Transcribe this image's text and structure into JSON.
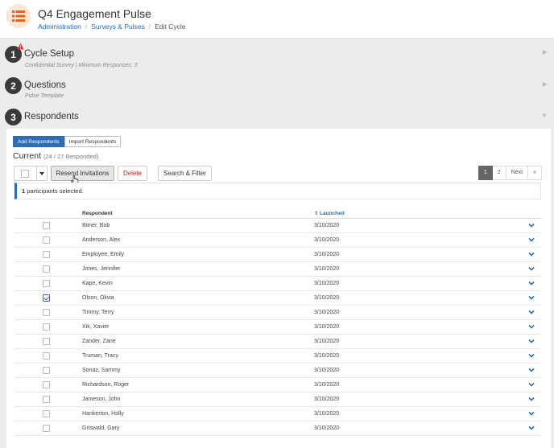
{
  "header": {
    "title": "Q4 Engagement Pulse",
    "breadcrumb": [
      "Administration",
      "Surveys & Pulses",
      "Edit Cycle"
    ],
    "icon": "list-icon",
    "accent": "#e8641b"
  },
  "steps": [
    {
      "number": "1",
      "title": "Cycle Setup",
      "subtitle": "Confidential Survey | Minimum Responses: 3"
    },
    {
      "number": "2",
      "title": "Questions",
      "subtitle": "Pulse Template"
    },
    {
      "number": "3",
      "title": "Respondents",
      "subtitle": ""
    }
  ],
  "respondents": {
    "tabs": [
      "Add Respondents",
      "Import Respondents"
    ],
    "current_label": "Current",
    "current_count": "(24 / 27 Responded)",
    "actions": {
      "resend": "Resend Invitations",
      "delete": "Delete",
      "search": "Search & Filter"
    },
    "pager": [
      "1",
      "2",
      "Next",
      "»"
    ],
    "selected_count": "1",
    "selected_text": "participants selected.",
    "columns": {
      "respondent": "Respondent",
      "launched": "Launched"
    },
    "rows": [
      {
        "name": "Bitner, Bob",
        "launched": "3/10/2020",
        "checked": false
      },
      {
        "name": "Anderson, Alex",
        "launched": "3/10/2020",
        "checked": false
      },
      {
        "name": "Employee, Emily",
        "launched": "3/10/2020",
        "checked": false
      },
      {
        "name": "Jones, Jennifer",
        "launched": "3/10/2020",
        "checked": false
      },
      {
        "name": "Kape, Kevin",
        "launched": "3/10/2020",
        "checked": false
      },
      {
        "name": "Olson, Olivia",
        "launched": "3/10/2020",
        "checked": true
      },
      {
        "name": "Timmy, Terry",
        "launched": "3/10/2020",
        "checked": false
      },
      {
        "name": "Xik, Xavier",
        "launched": "3/10/2020",
        "checked": false
      },
      {
        "name": "Zander, Zane",
        "launched": "3/10/2020",
        "checked": false
      },
      {
        "name": "Truman, Tracy",
        "launched": "3/10/2020",
        "checked": false
      },
      {
        "name": "Sonaz, Sammy",
        "launched": "3/10/2020",
        "checked": false
      },
      {
        "name": "Richardson, Roger",
        "launched": "3/10/2020",
        "checked": false
      },
      {
        "name": "Jameson, John",
        "launched": "3/10/2020",
        "checked": false
      },
      {
        "name": "Hankerton, Holly",
        "launched": "3/10/2020",
        "checked": false
      },
      {
        "name": "Griswald, Gary",
        "launched": "3/10/2020",
        "checked": false
      }
    ]
  },
  "colors": {
    "primary": "#2c6eb5",
    "delete": "#bb2222",
    "warning": "#d9332b"
  }
}
